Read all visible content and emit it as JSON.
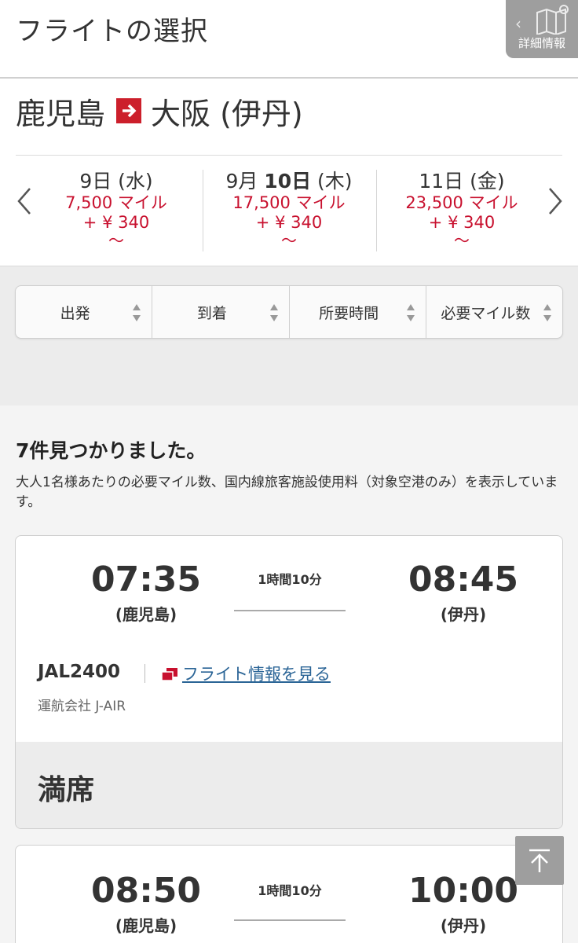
{
  "header": {
    "title": "フライトの選択",
    "detail_label": "詳細情報"
  },
  "route": {
    "from": "鹿児島",
    "to": "大阪 (伊丹)"
  },
  "dates": [
    {
      "day": "9日 (水)",
      "miles": "7,500 マイル",
      "fee": "+ ¥ 340",
      "tilde": "〜"
    },
    {
      "month": "9月",
      "day": "10日",
      "weekday": "(木)",
      "miles": "17,500 マイル",
      "fee": "+ ¥ 340",
      "tilde": "〜"
    },
    {
      "day": "11日 (金)",
      "miles": "23,500 マイル",
      "fee": "+ ¥ 340",
      "tilde": "〜"
    }
  ],
  "sort": {
    "items": [
      "出発",
      "到着",
      "所要時間",
      "必要マイル数"
    ]
  },
  "results": {
    "count_text": "7件見つかりました。",
    "note": "大人1名様あたりの必要マイル数、国内線旅客施設使用料（対象空港のみ）を表示しています。"
  },
  "flights": [
    {
      "dep_time": "07:35",
      "dep_airport": "(鹿児島)",
      "duration": "1時間10分",
      "arr_time": "08:45",
      "arr_airport": "(伊丹)",
      "flight_no": "JAL2400",
      "info_link": "フライト情報を見る",
      "operator": "運航会社 J-AIR",
      "status": "満席"
    },
    {
      "dep_time": "08:50",
      "dep_airport": "(鹿児島)",
      "duration": "1時間10分",
      "arr_time": "10:00",
      "arr_airport": "(伊丹)"
    }
  ],
  "colors": {
    "accent_red": "#c8102e",
    "link_blue": "#2a6496",
    "gray_button": "#9e9e9e"
  }
}
